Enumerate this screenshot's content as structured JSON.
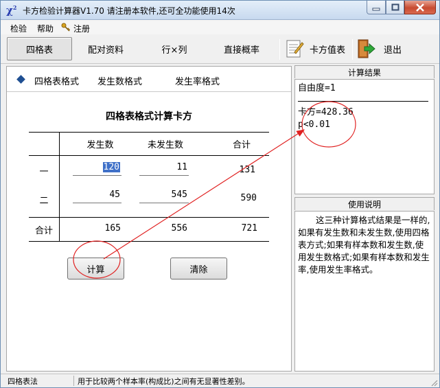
{
  "window": {
    "title": "卡方检验计算器V1.70    请注册本软件,还可全功能使用14次",
    "app_icon_text": "χ",
    "app_icon_sup": "2"
  },
  "menu": {
    "items": [
      "检验",
      "帮助",
      "注册"
    ]
  },
  "toolbar": {
    "tabs": [
      "四格表",
      "配对资料",
      "行×列",
      "直接概率"
    ],
    "chi_table_label": "卡方值表",
    "exit_label": "退出"
  },
  "subtabs": [
    "四格表格式",
    "发生数格式",
    "发生率格式"
  ],
  "table": {
    "title": "四格表格式计算卡方",
    "headers": [
      "发生数",
      "未发生数",
      "合计"
    ],
    "rows": [
      {
        "label": "一",
        "occur": "120",
        "not_occur": "11",
        "total": "131"
      },
      {
        "label": "二",
        "occur": "45",
        "not_occur": "545",
        "total": "590"
      }
    ],
    "total_row": {
      "label": "合计",
      "occur": "165",
      "not_occur": "556",
      "total": "721"
    }
  },
  "buttons": {
    "calculate": "计算",
    "clear": "清除"
  },
  "results": {
    "header": "计算结果",
    "lines": [
      "自由度=1",
      "卡方=428.36",
      "p<0.01"
    ]
  },
  "help": {
    "header": "使用说明",
    "text": "这三种计算格式结果是一样的,如果有发生数和未发生数,使用四格表方式;如果有样本数和发生数,使用发生数格式;如果有样本数和发生率,使用发生率格式。"
  },
  "status": {
    "mode": "四格表法",
    "description": "用于比较两个样本率(构成比)之间有无显著性差别。"
  },
  "annotation_color": "#e02020"
}
